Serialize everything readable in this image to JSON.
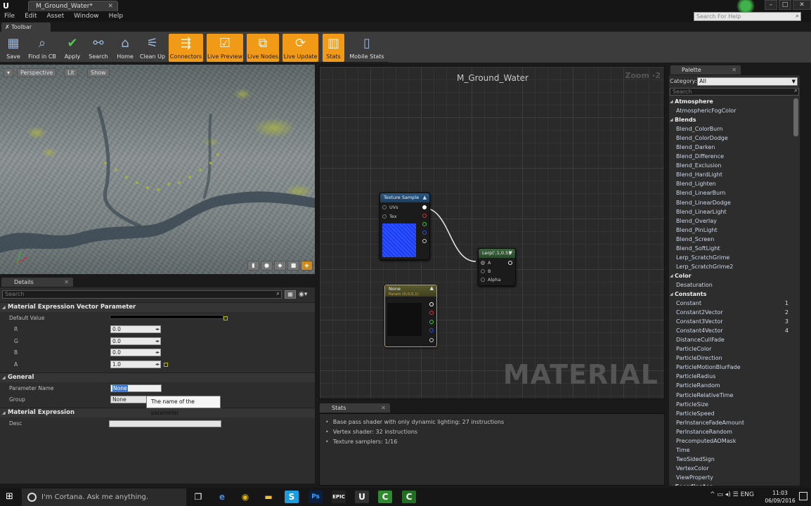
{
  "window": {
    "tab_title": "M_Ground_Water*",
    "logo": "U",
    "buttons": [
      "–",
      "□",
      "✕"
    ]
  },
  "menu": [
    "File",
    "Edit",
    "Asset",
    "Window",
    "Help"
  ],
  "help_search": {
    "placeholder": "Search For Help"
  },
  "toolbar": {
    "tab_label": "Toolbar",
    "items": [
      {
        "label": "Save",
        "icon": "save-icon",
        "active": false
      },
      {
        "label": "Find in CB",
        "icon": "magnifier-icon",
        "active": false
      },
      {
        "label": "Apply",
        "icon": "checkmark-icon",
        "active": false
      },
      {
        "label": "Search",
        "icon": "binoculars-icon",
        "active": false
      },
      {
        "label": "Home",
        "icon": "home-icon",
        "active": false
      },
      {
        "label": "Clean Up",
        "icon": "broom-icon",
        "active": false
      },
      {
        "label": "Connectors",
        "icon": "connectors-icon",
        "active": true
      },
      {
        "label": "Live Preview",
        "icon": "live-preview-icon",
        "active": true
      },
      {
        "label": "Live Nodes",
        "icon": "live-nodes-icon",
        "active": true
      },
      {
        "label": "Live Update",
        "icon": "live-update-icon",
        "active": true
      },
      {
        "label": "Stats",
        "icon": "stats-icon",
        "active": true
      },
      {
        "label": "Mobile Stats",
        "icon": "mobile-stats-icon",
        "active": false
      }
    ]
  },
  "viewport": {
    "buttons": [
      "Perspective",
      "Lit",
      "Show"
    ]
  },
  "details": {
    "tab_label": "Details",
    "search_placeholder": "Search",
    "categories": {
      "vector_param": "Material Expression Vector Parameter",
      "general": "General",
      "expression": "Material Expression"
    },
    "default_value_label": "Default Value",
    "channels": [
      {
        "label": "R",
        "value": "0.0"
      },
      {
        "label": "G",
        "value": "0.0"
      },
      {
        "label": "B",
        "value": "0.0"
      },
      {
        "label": "A",
        "value": "1.0"
      }
    ],
    "parameter_name_label": "Parameter Name",
    "parameter_name_value": "None",
    "group_label": "Group",
    "group_value": "None",
    "tooltip": "The name of the parameter",
    "desc_label": "Desc"
  },
  "graph": {
    "title": "M_Ground_Water",
    "zoom": "Zoom -2",
    "watermark": "MATERIAL",
    "texture_node": {
      "title": "Texture Sample",
      "inputs": [
        "UVs",
        "Tex"
      ]
    },
    "lerp_node": {
      "title": "Lerp(',1,0.5)",
      "inputs": [
        "A",
        "B",
        "Alpha"
      ]
    },
    "param_node": {
      "title": "None",
      "subtitle": "Param (0,0,0,1)"
    }
  },
  "stats": {
    "tab_label": "Stats",
    "lines": [
      "Base pass shader with only dynamic lighting: 27 instructions",
      "Vertex shader: 32 instructions",
      "Texture samplers: 1/16"
    ]
  },
  "palette": {
    "tab_label": "Palette",
    "category_label": "Category:",
    "category_value": "All",
    "search_placeholder": "Search",
    "rows": [
      {
        "text": "Atmosphere",
        "cat": true,
        "hk": ""
      },
      {
        "text": "AtmosphericFogColor",
        "cat": false,
        "hk": ""
      },
      {
        "text": "Blends",
        "cat": true,
        "hk": ""
      },
      {
        "text": "Blend_ColorBurn",
        "cat": false,
        "hk": ""
      },
      {
        "text": "Blend_ColorDodge",
        "cat": false,
        "hk": ""
      },
      {
        "text": "Blend_Darken",
        "cat": false,
        "hk": ""
      },
      {
        "text": "Blend_Difference",
        "cat": false,
        "hk": ""
      },
      {
        "text": "Blend_Exclusion",
        "cat": false,
        "hk": ""
      },
      {
        "text": "Blend_HardLight",
        "cat": false,
        "hk": ""
      },
      {
        "text": "Blend_Lighten",
        "cat": false,
        "hk": ""
      },
      {
        "text": "Blend_LinearBurn",
        "cat": false,
        "hk": ""
      },
      {
        "text": "Blend_LinearDodge",
        "cat": false,
        "hk": ""
      },
      {
        "text": "Blend_LinearLight",
        "cat": false,
        "hk": ""
      },
      {
        "text": "Blend_Overlay",
        "cat": false,
        "hk": ""
      },
      {
        "text": "Blend_PinLight",
        "cat": false,
        "hk": ""
      },
      {
        "text": "Blend_Screen",
        "cat": false,
        "hk": ""
      },
      {
        "text": "Blend_SoftLight",
        "cat": false,
        "hk": ""
      },
      {
        "text": "Lerp_ScratchGrime",
        "cat": false,
        "hk": ""
      },
      {
        "text": "Lerp_ScratchGrime2",
        "cat": false,
        "hk": ""
      },
      {
        "text": "Color",
        "cat": true,
        "hk": ""
      },
      {
        "text": "Desaturation",
        "cat": false,
        "hk": ""
      },
      {
        "text": "Constants",
        "cat": true,
        "hk": ""
      },
      {
        "text": "Constant",
        "cat": false,
        "hk": "1"
      },
      {
        "text": "Constant2Vector",
        "cat": false,
        "hk": "2"
      },
      {
        "text": "Constant3Vector",
        "cat": false,
        "hk": "3"
      },
      {
        "text": "Constant4Vector",
        "cat": false,
        "hk": "4"
      },
      {
        "text": "DistanceCullFade",
        "cat": false,
        "hk": ""
      },
      {
        "text": "ParticleColor",
        "cat": false,
        "hk": ""
      },
      {
        "text": "ParticleDirection",
        "cat": false,
        "hk": ""
      },
      {
        "text": "ParticleMotionBlurFade",
        "cat": false,
        "hk": ""
      },
      {
        "text": "ParticleRadius",
        "cat": false,
        "hk": ""
      },
      {
        "text": "ParticleRandom",
        "cat": false,
        "hk": ""
      },
      {
        "text": "ParticleRelativeTime",
        "cat": false,
        "hk": ""
      },
      {
        "text": "ParticleSize",
        "cat": false,
        "hk": ""
      },
      {
        "text": "ParticleSpeed",
        "cat": false,
        "hk": ""
      },
      {
        "text": "PerInstanceFadeAmount",
        "cat": false,
        "hk": ""
      },
      {
        "text": "PerInstanceRandom",
        "cat": false,
        "hk": ""
      },
      {
        "text": "PrecomputedAOMask",
        "cat": false,
        "hk": ""
      },
      {
        "text": "Time",
        "cat": false,
        "hk": ""
      },
      {
        "text": "TwoSidedSign",
        "cat": false,
        "hk": ""
      },
      {
        "text": "VertexColor",
        "cat": false,
        "hk": ""
      },
      {
        "text": "ViewProperty",
        "cat": false,
        "hk": ""
      },
      {
        "text": "Coordinates",
        "cat": true,
        "hk": ""
      }
    ]
  },
  "taskbar": {
    "cortana_placeholder": "I'm Cortana. Ask me anything.",
    "apps": [
      "task-view-icon",
      "edge-icon",
      "chrome-icon",
      "file-explorer-icon",
      "skype-icon",
      "photoshop-icon",
      "epic-launcher-icon",
      "unreal-icon",
      "camtasia-icon",
      "camtasia-recorder-icon"
    ],
    "language": "ENG",
    "time": "11:03",
    "date": "06/09/2016"
  },
  "colors": {
    "accent_orange": "#f09a17",
    "panel_dark": "#2d2d2d",
    "texture_blue": "#2244ee"
  }
}
